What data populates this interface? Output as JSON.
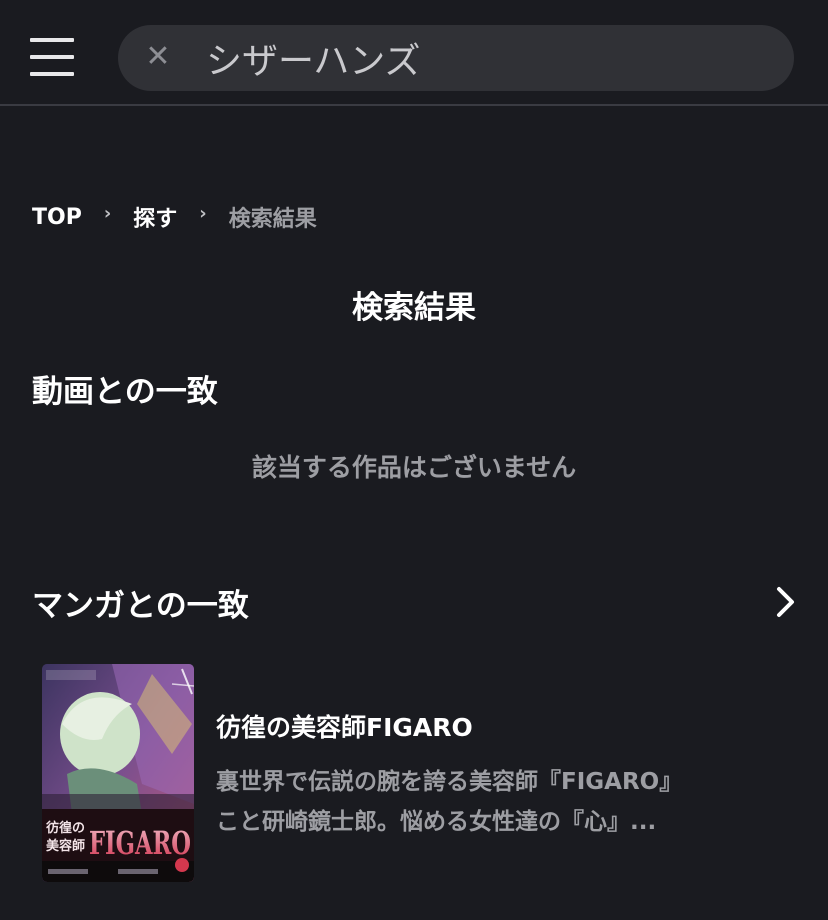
{
  "header": {
    "search": {
      "value": "シザーハンズ",
      "clear_icon": "close-icon"
    }
  },
  "breadcrumb": {
    "items": [
      "TOP",
      "探す",
      "検索結果"
    ],
    "separator": "›"
  },
  "page": {
    "title": "検索結果"
  },
  "video_section": {
    "title": "動画との一致",
    "empty_message": "該当する作品はございません"
  },
  "manga_section": {
    "title": "マンガとの一致",
    "more_icon": "chevron-right-icon",
    "items": [
      {
        "title": "彷徨の美容師FIGARO",
        "desc_line1": "裏世界で伝説の腕を誇る美容師『FIGARO』",
        "desc_line2": "こと研崎鏡士郎。悩める女性達の『心』...",
        "cover_logo": "FIGARO",
        "cover_kanji": "彷徨の美容師"
      }
    ]
  },
  "colors": {
    "background": "#1a1b20",
    "search_bg": "#303136",
    "muted_text": "#9d9ea3",
    "divider": "#3a3b42"
  }
}
